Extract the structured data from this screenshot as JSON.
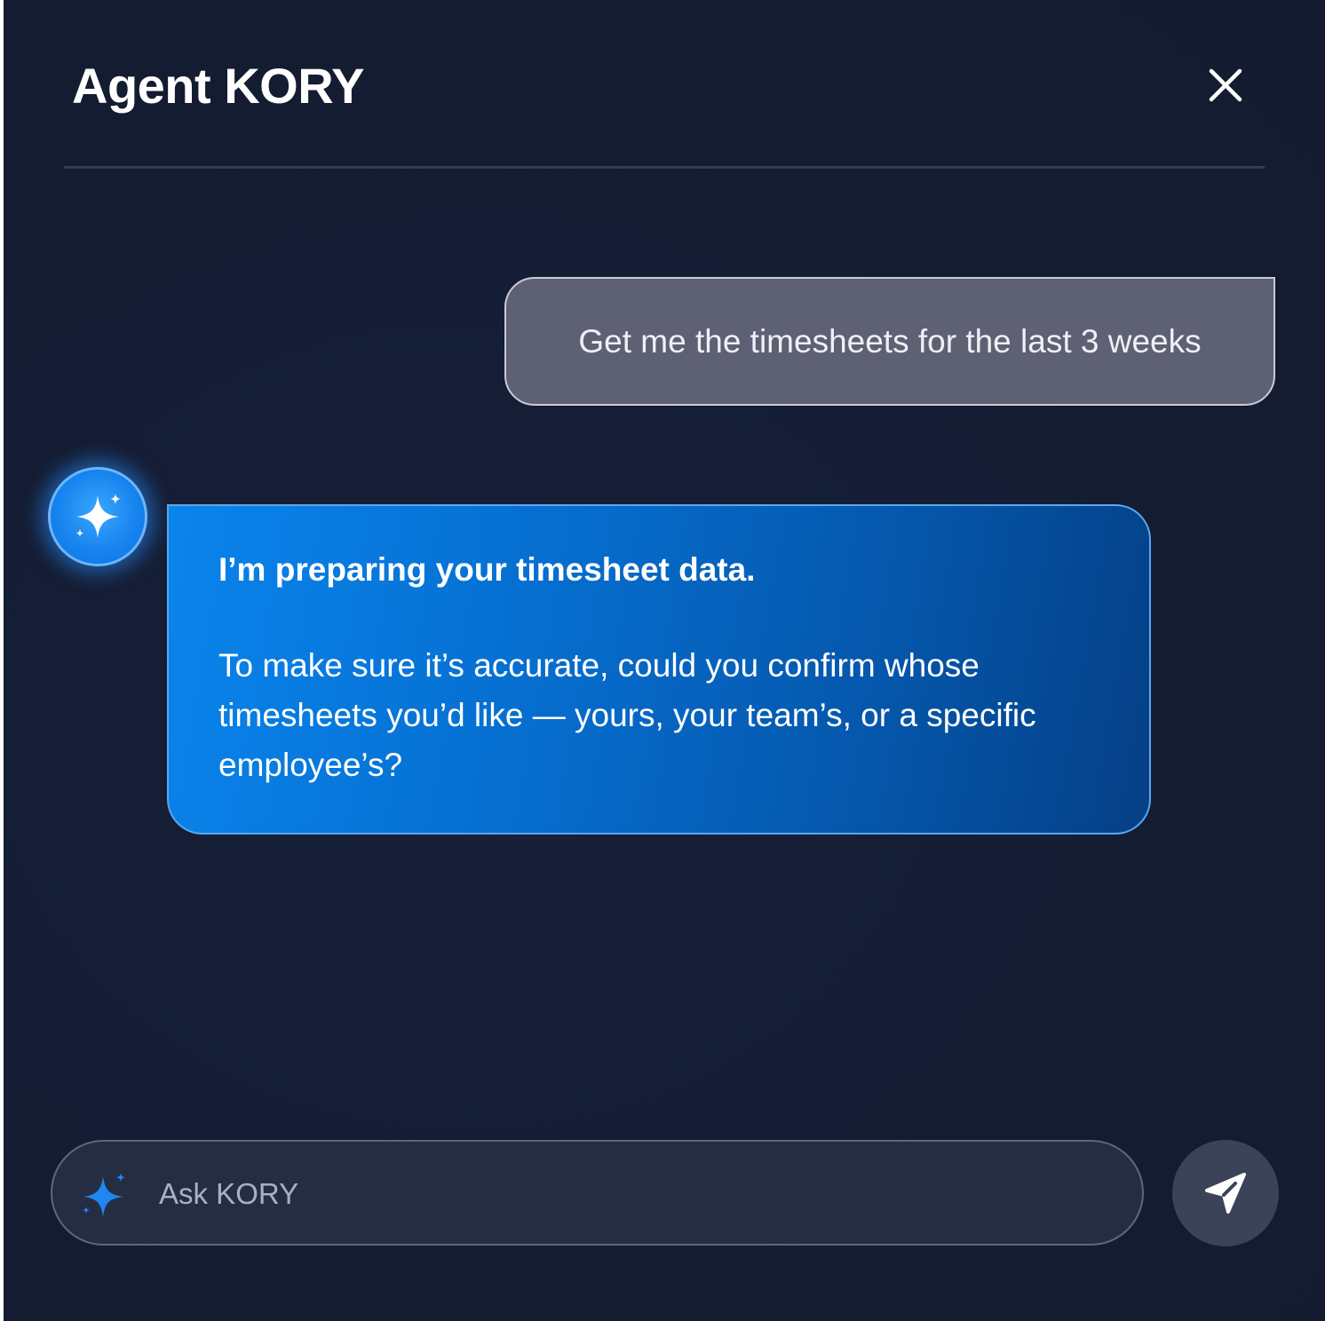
{
  "header": {
    "title": "Agent KORY",
    "close_icon": "close-icon"
  },
  "conversation": {
    "user_message": "Get me the timesheets for the last 3 weeks",
    "agent_avatar_icon": "sparkle-icon",
    "agent_message": {
      "heading": "I’m preparing your timesheet data.",
      "body": "To make sure it’s accurate, could you confirm whose timesheets you’d like — yours, your team’s, or a specific employee’s?"
    }
  },
  "composer": {
    "icon": "sparkle-icon",
    "placeholder": "Ask KORY",
    "value": "",
    "send_icon": "send-icon"
  },
  "colors": {
    "background": "#141d33",
    "user_bubble": "#5d6173",
    "agent_bubble_start": "#0a84ec",
    "agent_bubble_end": "#053f86",
    "accent": "#1683ee"
  }
}
